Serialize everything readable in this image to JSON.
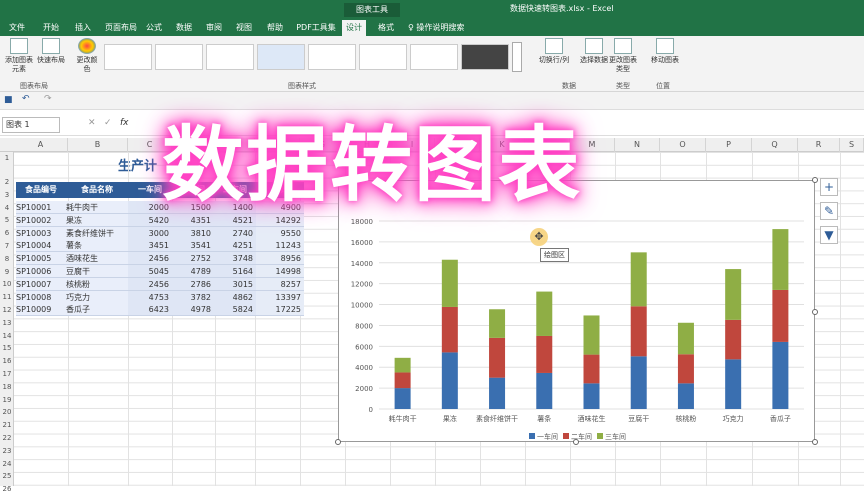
{
  "window": {
    "title": "数据快速转图表.xlsx - Excel",
    "context_tab": "图表工具"
  },
  "tabs": [
    "文件",
    "开始",
    "插入",
    "页面布局",
    "公式",
    "数据",
    "审阅",
    "视图",
    "帮助",
    "PDF工具集",
    "设计",
    "格式"
  ],
  "tell_me": "操作说明搜索",
  "ribbon": {
    "add_element": "添加图表元素",
    "quick_layout": "快速布局",
    "change_colors": "更改颜色",
    "switch_rowcol": "切换行/列",
    "select_data": "选择数据",
    "change_type": "更改图表类型",
    "move_chart": "移动图表",
    "group_layout": "图表布局",
    "group_styles": "图表样式",
    "group_data": "数据",
    "group_type": "类型",
    "group_location": "位置"
  },
  "namebox": "图表 1",
  "fx": "fx",
  "columns": [
    "A",
    "B",
    "C",
    "D",
    "E",
    "F",
    "G",
    "H",
    "I",
    "J",
    "K",
    "L",
    "M",
    "N",
    "O",
    "P",
    "Q",
    "R",
    "S"
  ],
  "rows": [
    "1",
    "2",
    "3",
    "4",
    "5",
    "6",
    "7",
    "8",
    "9",
    "10",
    "11",
    "12",
    "13",
    "14",
    "15",
    "16",
    "17",
    "18",
    "19",
    "20",
    "21",
    "22",
    "23",
    "24",
    "25",
    "26"
  ],
  "sheet_title": "生产计",
  "big_title": "数据转图表",
  "table": {
    "headers": [
      "食品编号",
      "食品名称",
      "一车间",
      "二车间",
      "三车间",
      "总计"
    ],
    "rows": [
      [
        "SP10001",
        "耗牛肉干",
        "2000",
        "1500",
        "1400",
        "4900"
      ],
      [
        "SP10002",
        "果冻",
        "5420",
        "4351",
        "4521",
        "14292"
      ],
      [
        "SP10003",
        "素食纤维饼干",
        "3000",
        "3810",
        "2740",
        "9550"
      ],
      [
        "SP10004",
        "薯条",
        "3451",
        "3541",
        "4251",
        "11243"
      ],
      [
        "SP10005",
        "酒味花生",
        "2456",
        "2752",
        "3748",
        "8956"
      ],
      [
        "SP10006",
        "豆腐干",
        "5045",
        "4789",
        "5164",
        "14998"
      ],
      [
        "SP10007",
        "核桃粉",
        "2456",
        "2786",
        "3015",
        "8257"
      ],
      [
        "SP10008",
        "巧克力",
        "4753",
        "3782",
        "4862",
        "13397"
      ],
      [
        "SP10009",
        "香瓜子",
        "6423",
        "4978",
        "5824",
        "17225"
      ]
    ]
  },
  "tooltip": "绘图区",
  "chart_data": {
    "type": "bar",
    "stacked": true,
    "categories": [
      "耗牛肉干",
      "果冻",
      "素食纤维饼干",
      "薯条",
      "酒味花生",
      "豆腐干",
      "核桃粉",
      "巧克力",
      "香瓜子"
    ],
    "series": [
      {
        "name": "一车间",
        "color": "#3a6fb0",
        "values": [
          2000,
          5420,
          3000,
          3451,
          2456,
          5045,
          2456,
          4753,
          6423
        ]
      },
      {
        "name": "二车间",
        "color": "#c0473d",
        "values": [
          1500,
          4351,
          3810,
          3541,
          2752,
          4789,
          2786,
          3782,
          4978
        ]
      },
      {
        "name": "三车间",
        "color": "#8fae45",
        "values": [
          1400,
          4521,
          2740,
          4251,
          3748,
          5164,
          3015,
          4862,
          5824
        ]
      }
    ],
    "ylim": [
      0,
      18000
    ],
    "yticks": [
      0,
      2000,
      4000,
      6000,
      8000,
      10000,
      12000,
      14000,
      16000,
      18000
    ],
    "legend": "bottom"
  }
}
